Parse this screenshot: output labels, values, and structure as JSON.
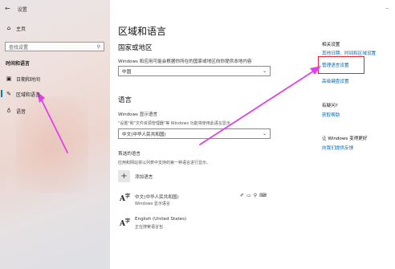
{
  "window": {
    "title": "设置",
    "minimize_icon": "minimize-icon"
  },
  "sidebar": {
    "home": "主页",
    "search_placeholder": "查找设置",
    "section": "时间和语言",
    "items": [
      {
        "label": "日期和时间",
        "icon": "calendar-clock-icon"
      },
      {
        "label": "区域和语言",
        "icon": "region-language-icon",
        "selected": true
      },
      {
        "label": "语音",
        "icon": "microphone-icon"
      }
    ]
  },
  "main": {
    "title": "区域和语言",
    "region": {
      "heading": "国家或地区",
      "desc": "Windows 和应用可能会根据你所在的国家或地区向你提供本地内容",
      "value": "中国"
    },
    "language": {
      "heading": "语言",
      "display_label": "Windows 显示语言",
      "display_desc": "\"设置\"和\"文件资源管理器\"等 Windows 功能将使用此语言显示。",
      "display_value": "中文(中华人民共和国)",
      "preferred_label": "首选的语言",
      "preferred_desc": "应用和网站将以列表中支持的第一种语言进行显示。",
      "add_label": "添加语言",
      "items": [
        {
          "name": "中文(中华人民共和国)",
          "sub": "Windows 显示语言"
        },
        {
          "name": "English (United States)",
          "sub": "正在搜索语言包"
        }
      ]
    }
  },
  "right": {
    "related_heading": "相关设置",
    "links": [
      "其他日期、时间和区域设置",
      "管理语言设置",
      "高级键盘设置"
    ],
    "question_heading": "有疑问?",
    "help_link": "获取帮助",
    "improve_heading": "让 Windows 变得更好",
    "feedback_link": "向我们提供反馈"
  },
  "colors": {
    "accent": "#0078d7",
    "link": "#0067b8",
    "highlight": "#e0262e",
    "arrow": "#e040e8"
  }
}
